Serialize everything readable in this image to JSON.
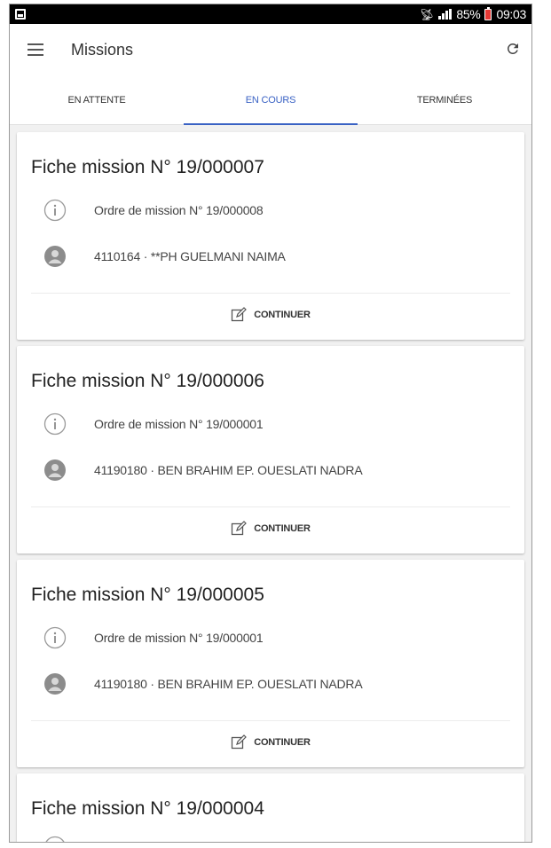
{
  "status_bar": {
    "battery_percent": "85%",
    "time": "09:03",
    "icons": [
      "image-icon",
      "antenna-icon",
      "signal-icon",
      "battery-icon"
    ]
  },
  "app_bar": {
    "title": "Missions",
    "menu_icon": "menu-icon",
    "refresh_icon": "refresh-icon"
  },
  "tabs": [
    {
      "label": "EN ATTENTE",
      "active": false
    },
    {
      "label": "EN COURS",
      "active": true
    },
    {
      "label": "TERMINÉES",
      "active": false
    }
  ],
  "colors": {
    "accent": "#3a62c4",
    "battery_low": "#e53935"
  },
  "missions": [
    {
      "title": "Fiche mission N° 19/000007",
      "order": "Ordre de mission N° 19/000008",
      "person": "4110164 · **PH GUELMANI NAIMA",
      "action": "CONTINUER"
    },
    {
      "title": "Fiche mission N° 19/000006",
      "order": "Ordre de mission N° 19/000001",
      "person": "41190180 · BEN BRAHIM EP. OUESLATI NADRA",
      "action": "CONTINUER"
    },
    {
      "title": "Fiche mission N° 19/000005",
      "order": "Ordre de mission N° 19/000001",
      "person": "41190180 · BEN BRAHIM EP. OUESLATI NADRA",
      "action": "CONTINUER"
    },
    {
      "title": "Fiche mission N° 19/000004"
    }
  ]
}
